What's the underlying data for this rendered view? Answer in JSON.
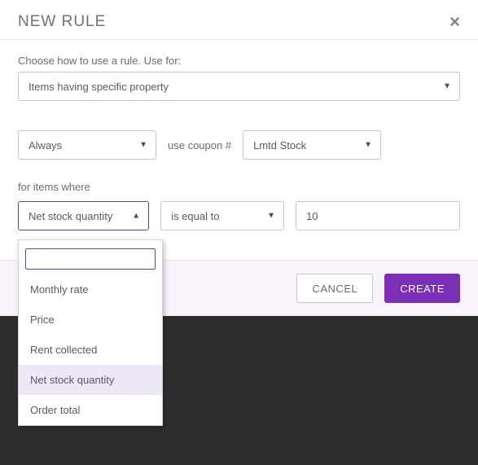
{
  "header": {
    "title": "NEW RULE",
    "close_glyph": "×"
  },
  "rule_type": {
    "label": "Choose how to use a rule. Use for:",
    "value": "Items having specific property"
  },
  "condition_row": {
    "when_value": "Always",
    "mid_text": "use coupon #",
    "coupon_value": "Lmtd Stock"
  },
  "items_where_label": "for items where",
  "property_select": {
    "value": "Net stock quantity",
    "search_value": "",
    "options": [
      "Monthly rate",
      "Price",
      "Rent collected",
      "Net stock quantity",
      "Order total"
    ],
    "selected_index": 3
  },
  "operator_select": {
    "value": "is equal to"
  },
  "value_input": {
    "value": "10"
  },
  "footer": {
    "cancel": "CANCEL",
    "create": "CREATE"
  },
  "carets": {
    "down": "▼",
    "up": "▲"
  }
}
